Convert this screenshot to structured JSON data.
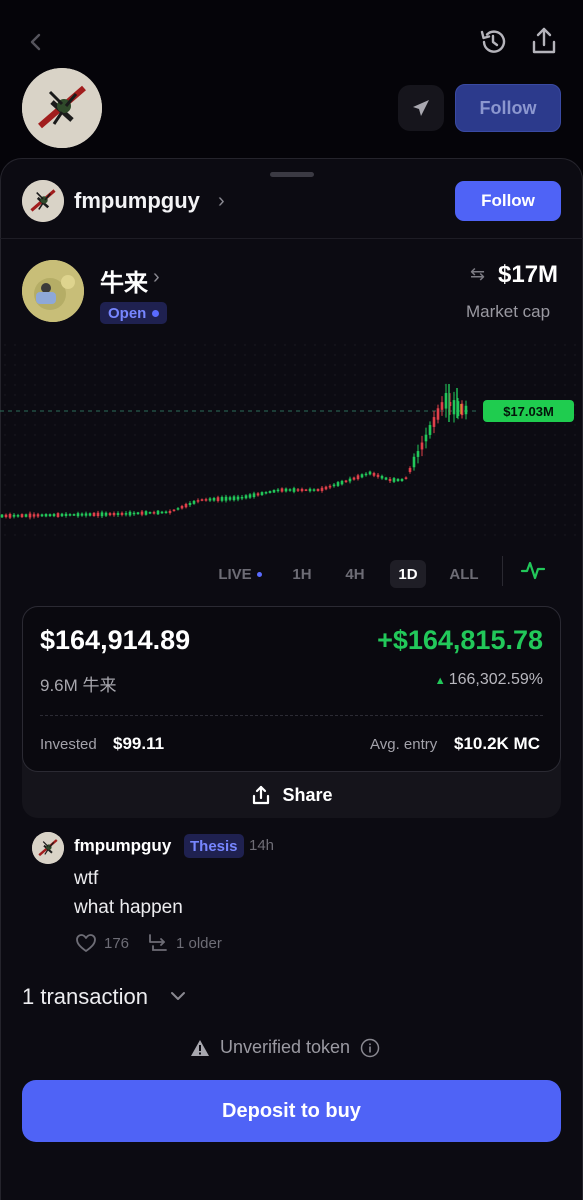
{
  "top_bar": {
    "follow_label": "Follow"
  },
  "creator": {
    "username": "fmpumpguy",
    "follow_label": "Follow"
  },
  "token": {
    "name": "牛来",
    "status": "Open",
    "market_cap_value": "$17M",
    "market_cap_label": "Market cap",
    "current_price_tag": "$17.03M"
  },
  "timeframes": [
    {
      "label": "LIVE",
      "selected": false
    },
    {
      "label": "1H",
      "selected": false
    },
    {
      "label": "4H",
      "selected": false
    },
    {
      "label": "1D",
      "selected": true
    },
    {
      "label": "ALL",
      "selected": false
    }
  ],
  "position": {
    "value": "$164,914.89",
    "pnl": "+$164,815.78",
    "amount": "9.6M 牛来",
    "pnl_percent": "166,302.59%",
    "invested_label": "Invested",
    "invested_value": "$99.11",
    "avg_entry_label": "Avg. entry",
    "avg_entry_value": "$10.2K MC",
    "share_label": "Share"
  },
  "comment": {
    "username": "fmpumpguy",
    "tag": "Thesis",
    "time": "14h",
    "line1": "wtf",
    "line2": "what happen",
    "likes": "176",
    "replies": "1 older"
  },
  "transactions_label": "1 transaction",
  "unverified_label": "Unverified token",
  "deposit_label": "Deposit to buy",
  "colors": {
    "accent": "#4f63f6",
    "positive": "#22c85a",
    "negative": "#e0404a",
    "background": "#050409"
  }
}
